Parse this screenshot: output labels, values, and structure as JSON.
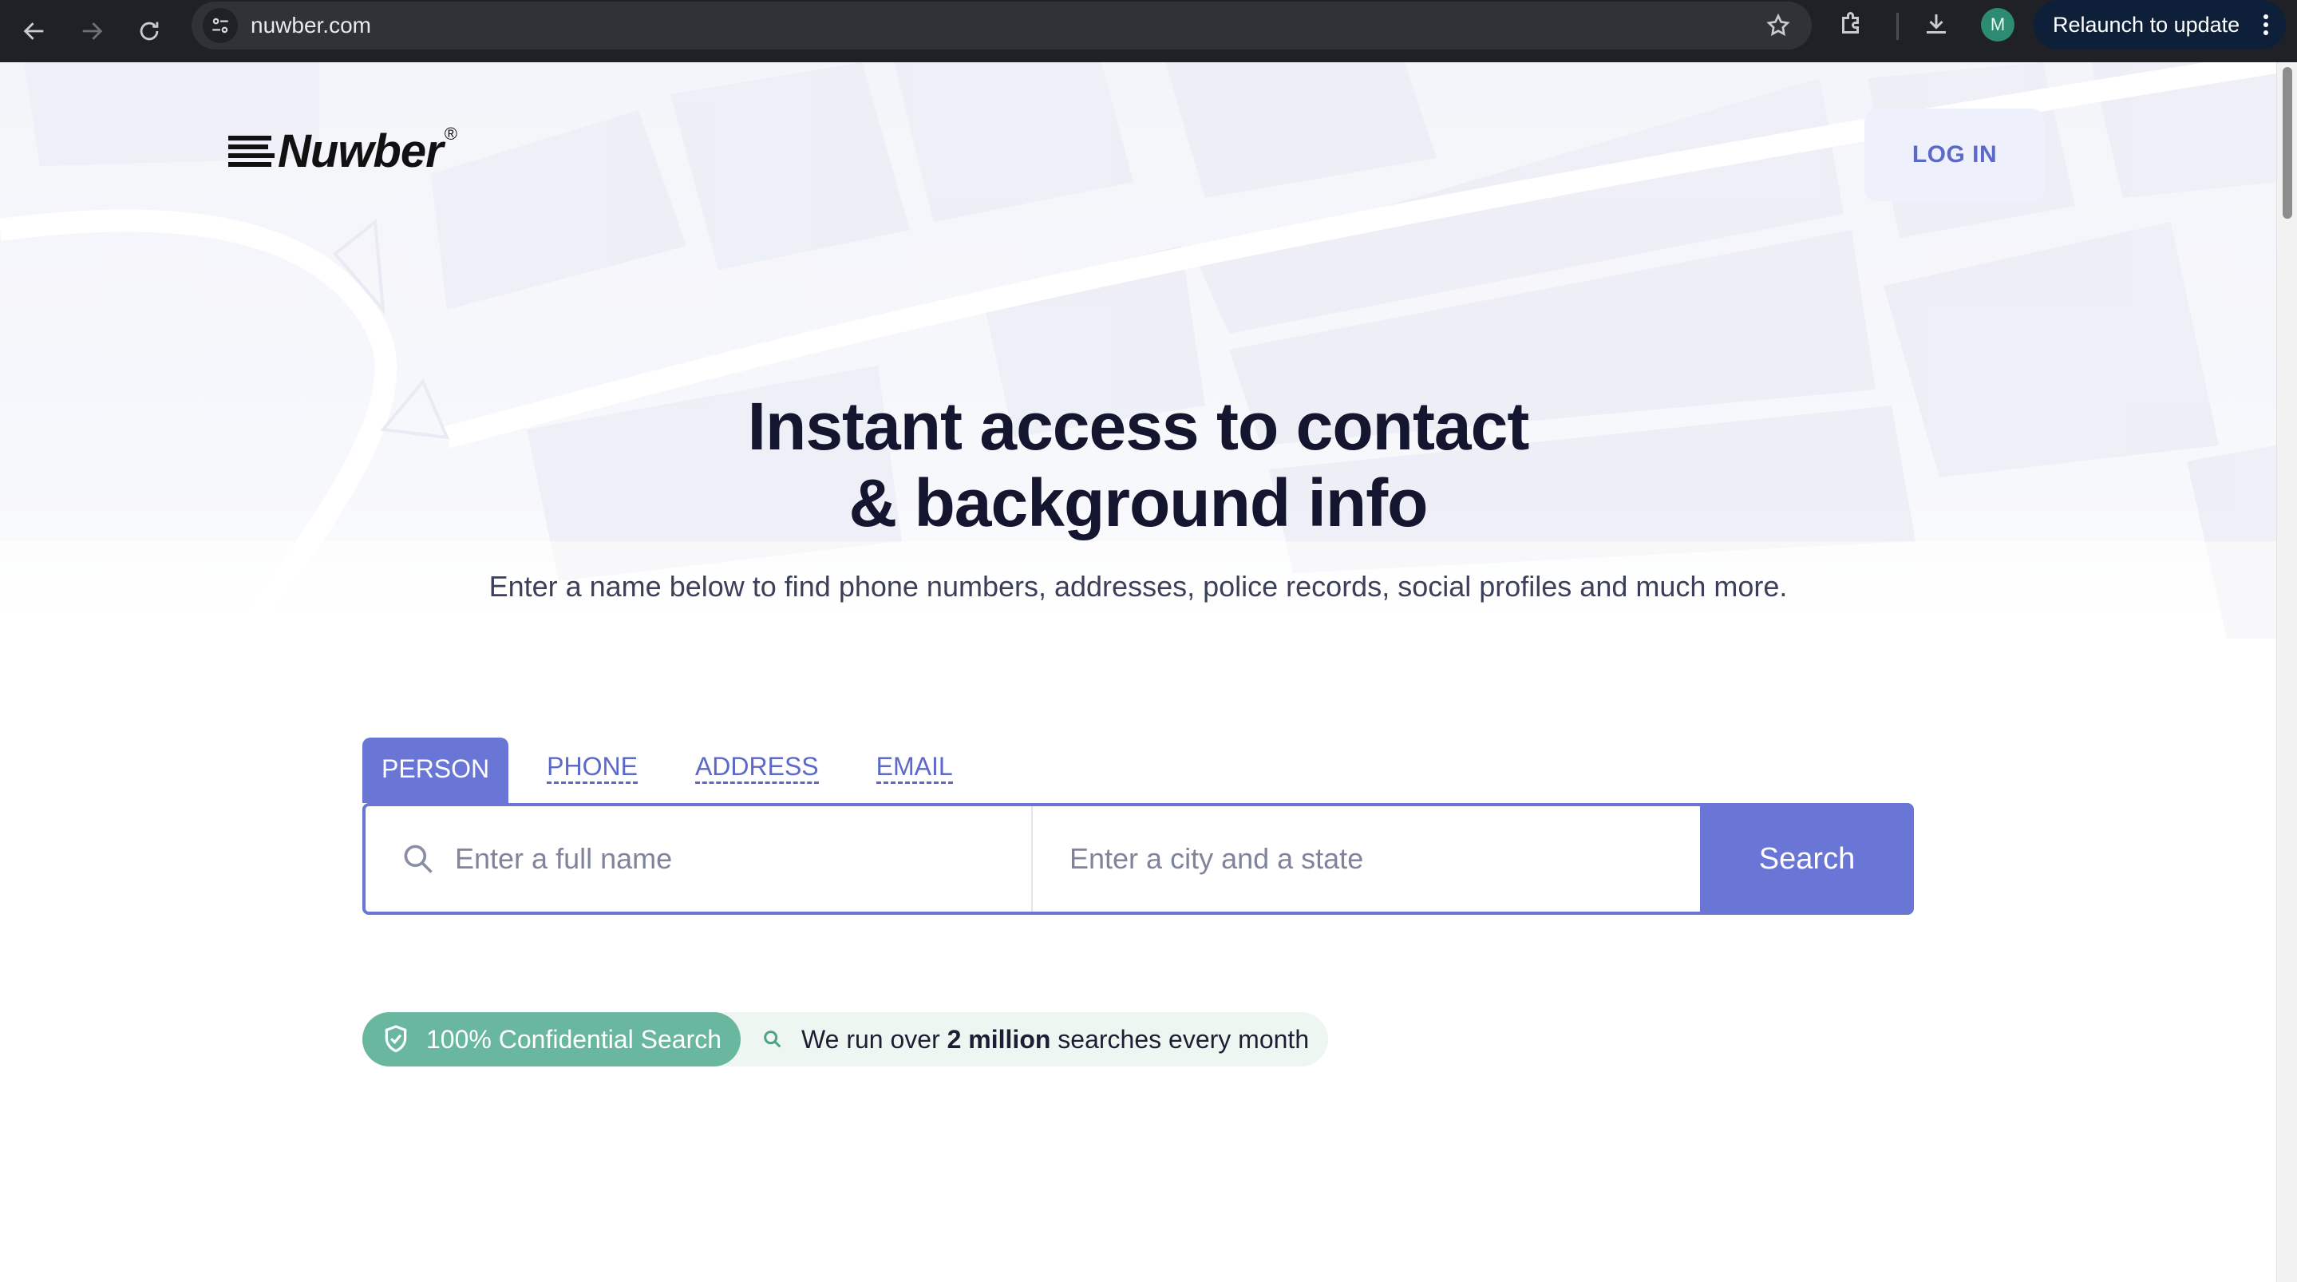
{
  "browser": {
    "url": "nuwber.com",
    "relaunch_label": "Relaunch to update",
    "profile_initial": "M",
    "icons": [
      "back-arrow-icon",
      "forward-arrow-icon",
      "reload-icon",
      "site-settings-icon",
      "bookmark-star-icon",
      "extensions-icon",
      "download-icon",
      "more-vert-icon"
    ]
  },
  "header": {
    "logo_text": "Nuwber",
    "logo_mark": "®",
    "login_label": "LOG IN"
  },
  "hero": {
    "headline_line1": "Instant access to contact",
    "headline_line2": "& background info",
    "subheadline": "Enter a name below to find phone numbers, addresses, police records, social profiles and much more."
  },
  "search": {
    "tabs": [
      {
        "label": "PERSON",
        "active": true
      },
      {
        "label": "PHONE",
        "active": false
      },
      {
        "label": "ADDRESS",
        "active": false
      },
      {
        "label": "EMAIL",
        "active": false
      }
    ],
    "name_placeholder": "Enter a full name",
    "location_placeholder": "Enter a city and a state",
    "button_label": "Search"
  },
  "badges": {
    "confidential": "100% Confidential Search",
    "stat_prefix": "We run over ",
    "stat_bold": "2 million",
    "stat_suffix": " searches every month"
  },
  "colors": {
    "accent": "#6a76d6",
    "headline": "#13162e",
    "badge_green": "#69b79f",
    "badge_light": "#eef6f2",
    "chrome_bg": "#1f2126"
  }
}
